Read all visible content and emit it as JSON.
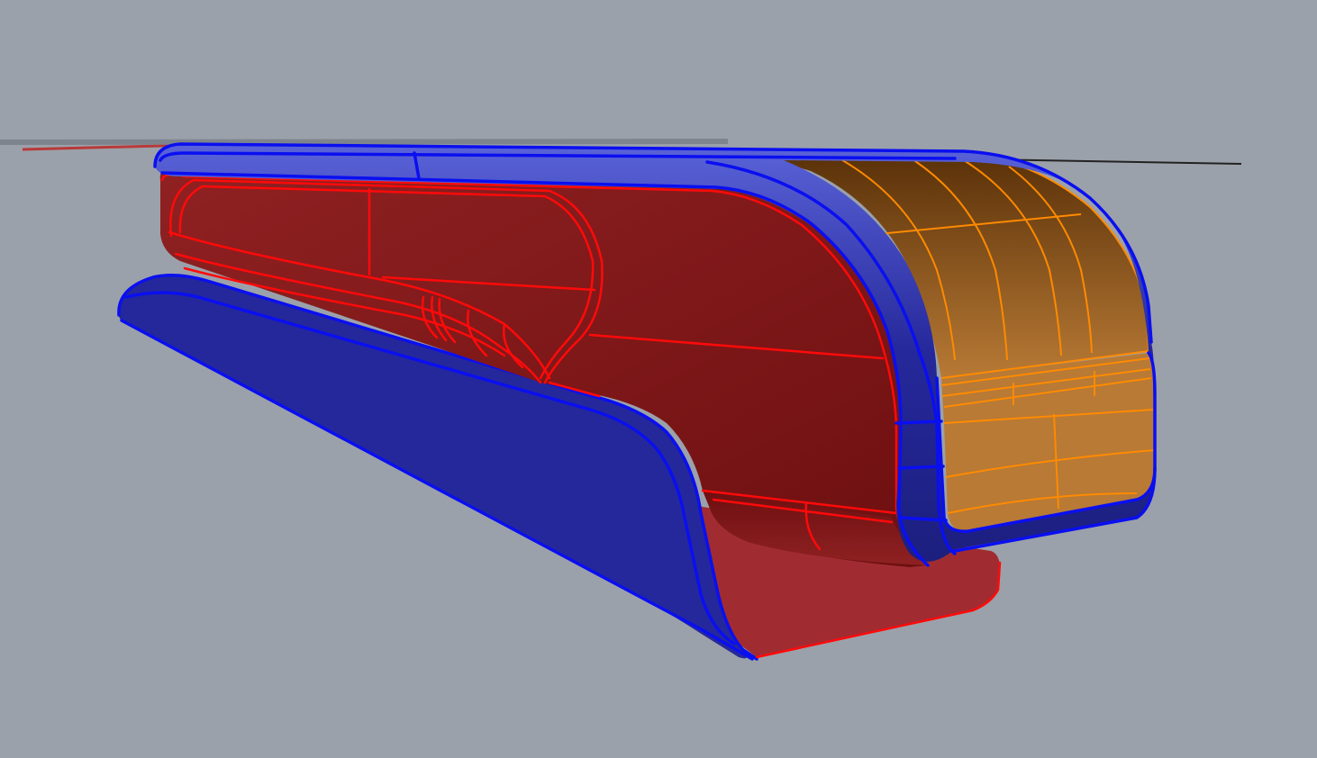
{
  "viewport": {
    "background": "#9ba1aa"
  },
  "colors": {
    "blue_edge": "#0a0ff0",
    "blue_fill_dark": "#1c1f7e",
    "blue_fill": "#25289a",
    "blue_highlight": "#5a63d8",
    "red_edge": "#ff0a0a",
    "red_fill": "#8f2122",
    "red_fill_dark": "#6e0f10",
    "red_floor": "#a02c32",
    "orange_edge": "#ff8a00",
    "orange_top": "#5a3109",
    "orange_bottom": "#b87a35",
    "axis_red": "#b83a3a",
    "axis_dark": "#222222"
  },
  "objects": [
    {
      "name": "top-blue-rounded-shell",
      "color_ref": "blue_edge"
    },
    {
      "name": "red-body-surface",
      "color_ref": "red_edge"
    },
    {
      "name": "orange-end-cap-surface",
      "color_ref": "orange_edge"
    },
    {
      "name": "bottom-blue-base-rail",
      "color_ref": "blue_edge"
    },
    {
      "name": "red-floor-panel",
      "color_ref": "red_edge"
    }
  ]
}
